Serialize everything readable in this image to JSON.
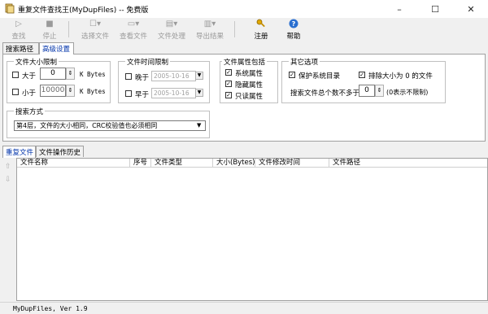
{
  "window": {
    "title": "重复文件查找王(MyDupFiles) -- 免费版",
    "controls": [
      "–",
      "☐",
      "✕"
    ]
  },
  "toolbar": {
    "search": "查找",
    "stop": "停止",
    "select_files": "选择文件",
    "view_file": "查看文件",
    "file_process": "文件处理",
    "export_results": "导出结果",
    "register": "注册",
    "help": "帮助"
  },
  "tabs_main": [
    "搜索路径",
    "高级设置"
  ],
  "size_group": {
    "title": "文件大小限制",
    "greater_label": "大于",
    "greater_value": "0",
    "greater_unit": "K Bytes",
    "less_label": "小于",
    "less_value": "10000",
    "less_unit": "K Bytes"
  },
  "time_group": {
    "title": "文件时间限制",
    "later_label": "晚于",
    "later_value": "2005-10-16",
    "earlier_label": "早于",
    "earlier_value": "2005-10-16"
  },
  "attr_group": {
    "title": "文件属性包括",
    "system": "系统属性",
    "hidden": "隐藏属性",
    "readonly": "只读属性"
  },
  "other_group": {
    "title": "其它选项",
    "protect_sys": "保护系统目录",
    "exclude_zero": "排除大小为 0 的文件",
    "max_files_label": "搜索文件总个数不多于:",
    "max_files_value": "0",
    "max_files_hint": "(0表示不限制)"
  },
  "search_mode": {
    "title": "搜索方式",
    "selected": "第4层，文件的大小相同，CRC校验值也必须相同"
  },
  "tabs_result": [
    "重复文件",
    "文件操作历史"
  ],
  "columns": [
    "文件名称",
    "序号",
    "文件类型",
    "大小(Bytes)",
    "文件修改时间",
    "文件路径"
  ],
  "status": "MyDupFiles, Ver 1.9"
}
